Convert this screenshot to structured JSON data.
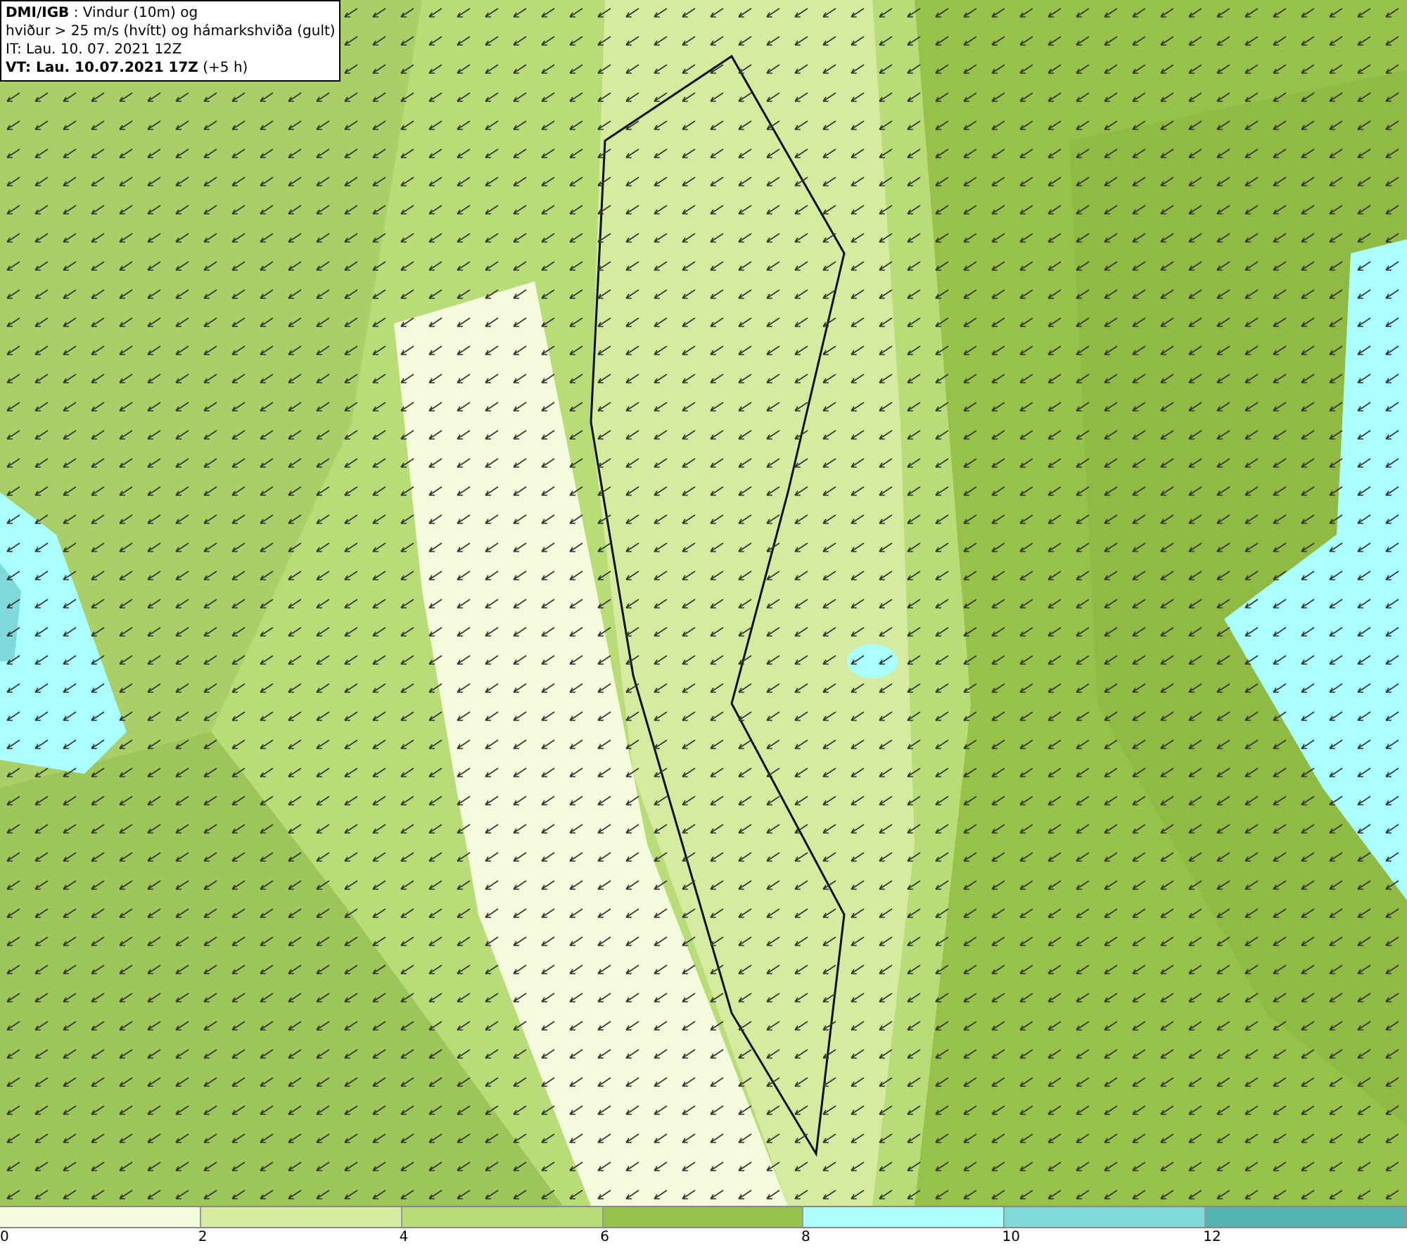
{
  "title_box": {
    "lines": [
      "**DMI/IGB** : Vindur (10m) og",
      "hviður > 25 m/s (hvítt) og hámarkshviða (gult)",
      "IT: Lau. 10. 07. 2021 12Z",
      "**VT: Lau. 10.07.2021 17Z** (+5 h)"
    ]
  },
  "legend": [
    {
      "label": "0",
      "color": "#f3fbdc"
    },
    {
      "label": "2",
      "color": "#d5eba0"
    },
    {
      "label": "4",
      "color": "#b8dc78"
    },
    {
      "label": "6",
      "color": "#97c24a"
    },
    {
      "label": "8",
      "color": "#aaffff"
    },
    {
      "label": "10",
      "color": "#7fd9d9"
    },
    {
      "label": "12",
      "color": "#55b3b3"
    }
  ]
}
